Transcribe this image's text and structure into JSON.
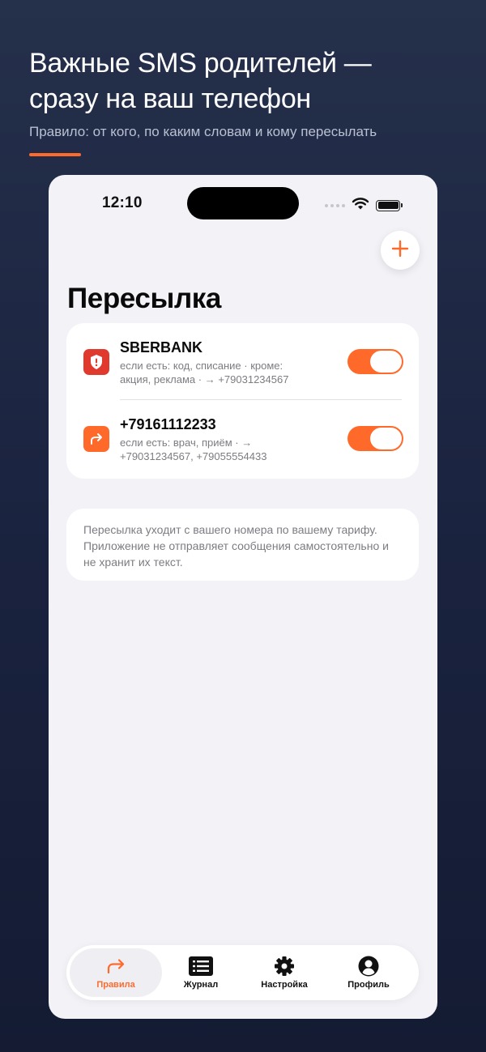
{
  "promo": {
    "title_line1": "Важные SMS родителей —",
    "title_line2": "сразу на ваш телефон",
    "subtitle": "Правило: от кого, по каким словам и кому пересылать",
    "accent_color": "#ff6a2b"
  },
  "status_bar": {
    "time": "12:10"
  },
  "header": {
    "title": "Пересылка",
    "add_icon": "plus-icon"
  },
  "rules": [
    {
      "title": "SBERBANK",
      "description": "если есть: код, списание · кроме: акция, реклама · → +79031234567",
      "icon": "shield-alert-icon",
      "icon_color": "#e03a2f",
      "enabled": true
    },
    {
      "title": "+79161112233",
      "description": "если есть: врач, приём · → +79031234567, +79055554433",
      "icon": "forward-arrow-icon",
      "icon_color": "#ff6a2b",
      "enabled": true
    }
  ],
  "info": {
    "text": "Пересылка уходит с вашего номера по вашему тарифу. Приложение не отправляет сообщения самостоятельно и не хранит их текст."
  },
  "tabs": [
    {
      "label": "Правила",
      "icon": "forward-arrow-icon",
      "active": true
    },
    {
      "label": "Журнал",
      "icon": "list-icon",
      "active": false
    },
    {
      "label": "Настройка",
      "icon": "gear-icon",
      "active": false
    },
    {
      "label": "Профиль",
      "icon": "person-icon",
      "active": false
    }
  ]
}
